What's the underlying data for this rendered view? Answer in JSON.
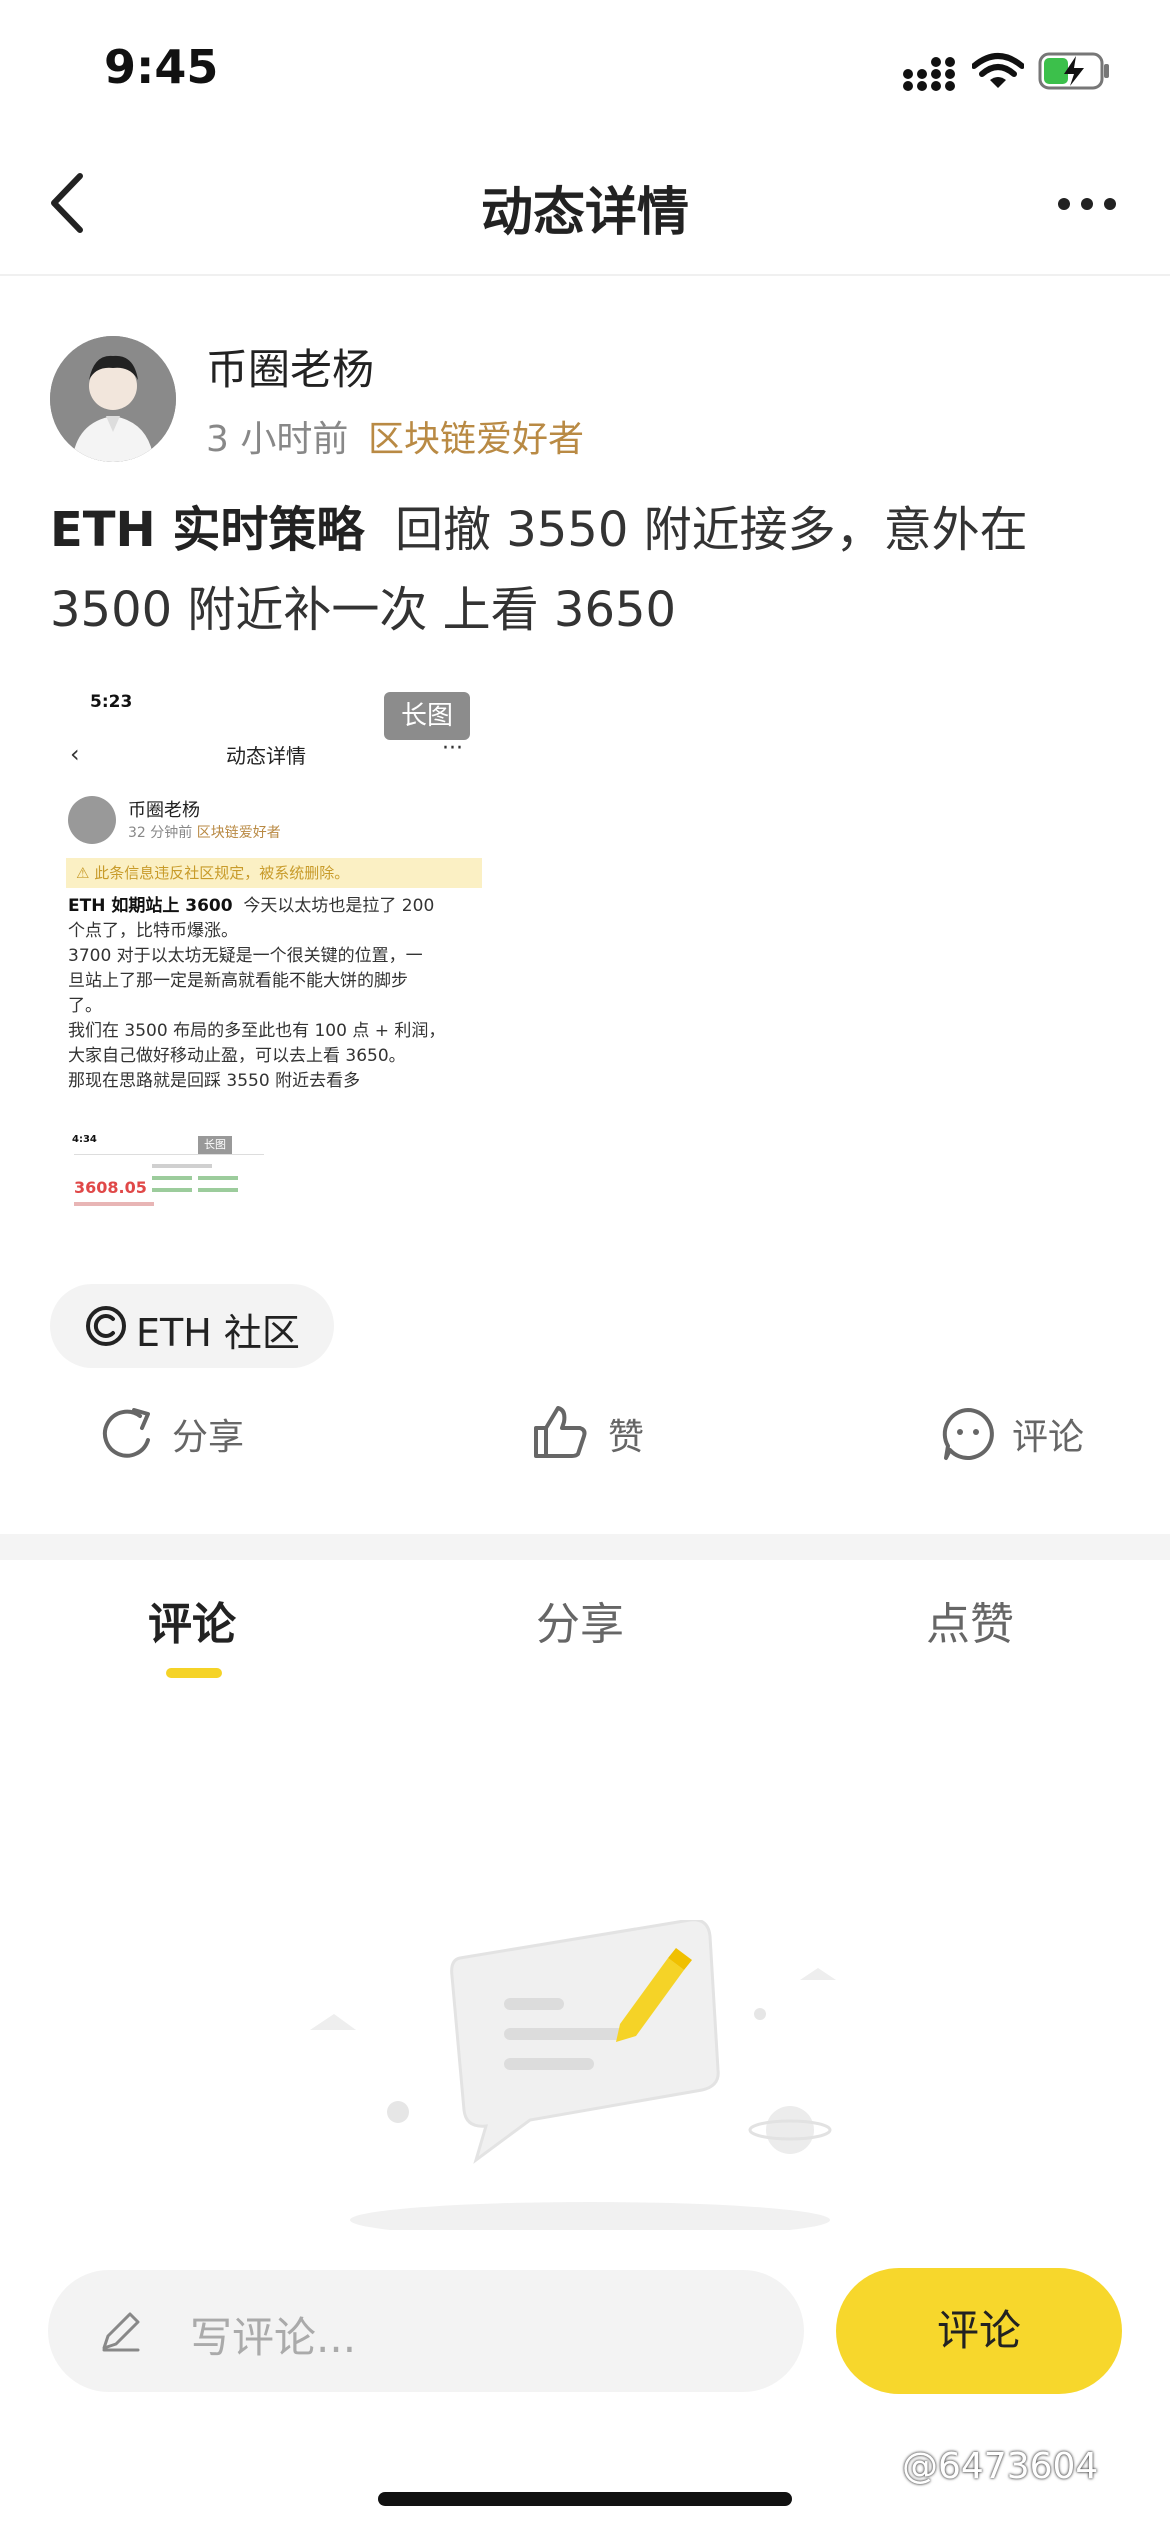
{
  "status_bar": {
    "time": "9:45"
  },
  "nav": {
    "title": "动态详情"
  },
  "post": {
    "author_name": "币圈老杨",
    "time": "3 小时前",
    "tag": "区块链爱好者",
    "title_bold": "ETH 实时策略",
    "text_line1_rest": "回撤 3550 附近接多，意外在",
    "text_line2": "3500 附近补一次 上看 3650"
  },
  "image": {
    "badge": "长图",
    "time": "5:23",
    "title": "动态详情",
    "author": "币圈老杨",
    "meta_time": "32 分钟前",
    "meta_tag": "区块链爱好者",
    "warning": "此条信息违反社区规定，被系统删除。",
    "body_bold": "ETH 如期站上 3600",
    "body_line1_rest": "今天以太坊也是拉了 200",
    "body_lines": [
      "个点了，比特币爆涨。",
      "3700 对于以太坊无疑是一个很关键的位置，一",
      "旦站上了那一定是新高就看能不能大饼的脚步",
      "了。",
      "我们在 3500 布局的多至此也有 100 点 + 利润，",
      "大家自己做好移动止盈，可以去上看 3650。",
      "那现在思路就是回踩 3550 附近去看多"
    ],
    "inner_time": "4:34",
    "inner_badge": "长图",
    "inner_price": "3608.05"
  },
  "community_tag": {
    "label": "ETH 社区"
  },
  "actions": {
    "share": "分享",
    "like": "赞",
    "comment": "评论"
  },
  "tabs": [
    {
      "label": "评论"
    },
    {
      "label": "分享"
    },
    {
      "label": "点赞"
    }
  ],
  "comment_bar": {
    "placeholder": "写评论...",
    "button": "评论"
  },
  "watermark": "@6473604",
  "colors": {
    "accent_yellow": "#f7d72c",
    "tag_gold": "#b98a44"
  }
}
